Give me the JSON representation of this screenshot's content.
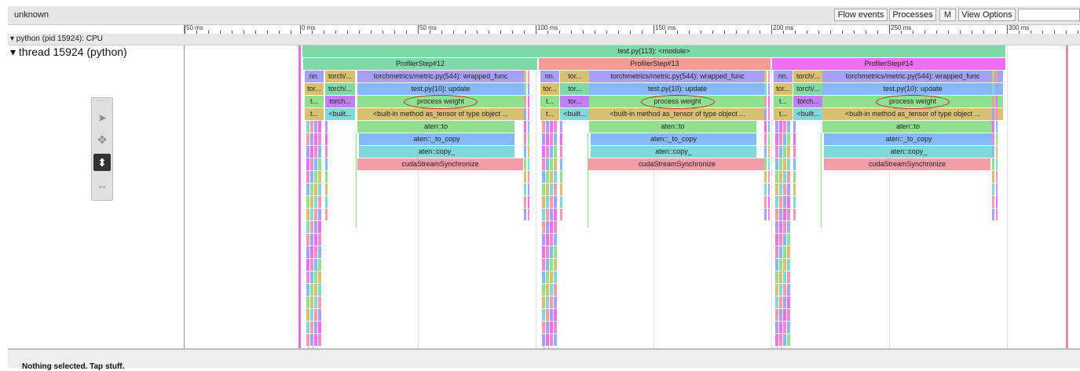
{
  "window": {
    "title": "unknown"
  },
  "toolbar": {
    "flow_events": "Flow events",
    "processes": "Processes",
    "metadata": "M",
    "view_options": "View Options"
  },
  "ruler": {
    "ticks": [
      "50 ms",
      "0 ms",
      "50 ms",
      "100 ms",
      "150 ms",
      "200 ms",
      "250 ms",
      "300 ms"
    ]
  },
  "process": {
    "label": "▾ python (pid 15924): CPU"
  },
  "thread": {
    "label": "▾  thread 15924 (python)"
  },
  "events": {
    "module": "test.py(113): <module>",
    "steps": [
      "ProfilerStep#12",
      "ProfilerStep#13",
      "ProfilerStep#14"
    ],
    "nn_short": "nn.",
    "torch_short_a": "torch/...",
    "torch_short_b": "tor...",
    "torch_short_c": "torch...",
    "t_short": "t...",
    "tor_short": "tor...",
    "built_short": "<built...",
    "built_short_b": "<built...",
    "wrapped_func": "torchmetrics/metric.py(544): wrapped_func",
    "update": "test.py(10): update",
    "process_weight": "process weight",
    "as_tensor": "<built-in method as_tensor of type object ...",
    "aten_to": "aten::to",
    "aten_to_copy": "aten::_to_copy",
    "aten_copy": "aten::copy_",
    "cuda_sync": "cudaStreamSynchronize"
  },
  "status": {
    "selection": "Nothing selected. Tap stuff."
  },
  "colors": {
    "module": "#80d8a8",
    "step12": "#80d8a8",
    "step13": "#f49c94",
    "step14": "#f06ef0",
    "wrapped": "#a8a0f8",
    "update": "#88b8f8",
    "process_weight": "#90e090",
    "as_tensor": "#d8c070",
    "aten_to": "#90e090",
    "to_copy": "#88b8f8",
    "copy": "#80d8d8",
    "cuda": "#f49ca8"
  }
}
